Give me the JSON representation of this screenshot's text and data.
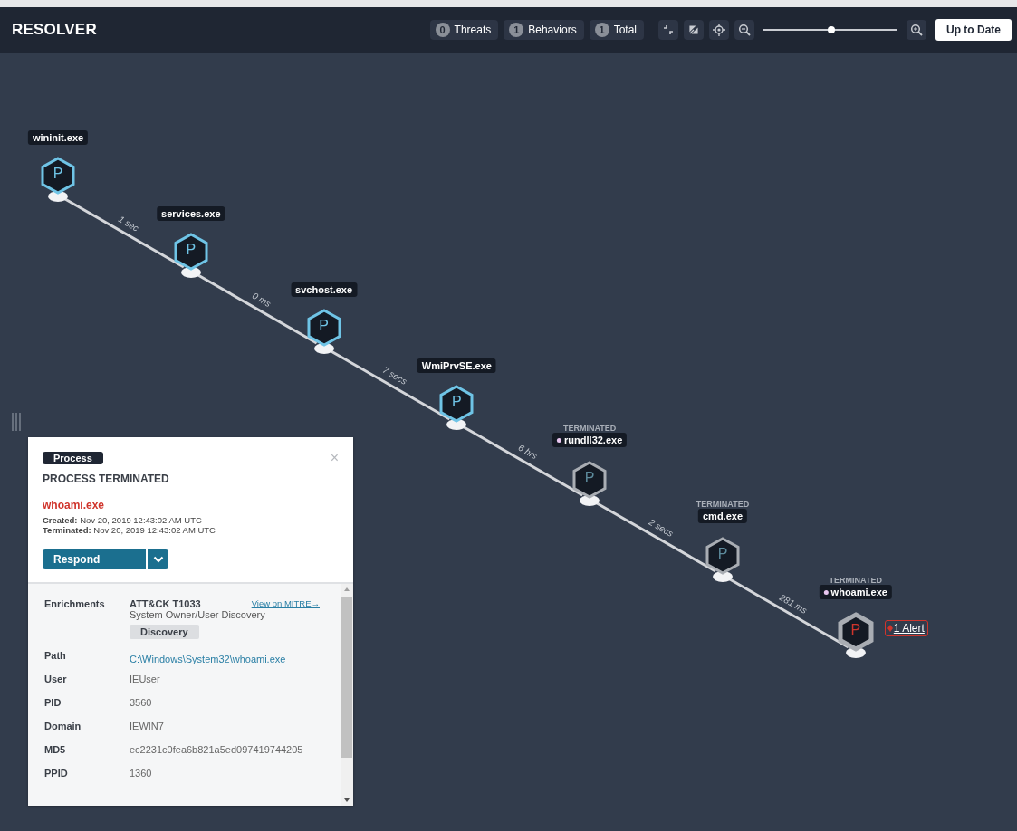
{
  "header": {
    "title": "RESOLVER",
    "counters": [
      {
        "count": "0",
        "label": "Threats"
      },
      {
        "count": "1",
        "label": "Behaviors"
      },
      {
        "count": "1",
        "label": "Total"
      }
    ],
    "zoom": {
      "level": 0.51
    },
    "status_button": "Up to Date"
  },
  "graph": {
    "nodes": [
      {
        "name": "wininit.exe",
        "glyph": "P",
        "terminated": false,
        "alert": false
      },
      {
        "name": "services.exe",
        "glyph": "P",
        "terminated": false,
        "alert": false
      },
      {
        "name": "svchost.exe",
        "glyph": "P",
        "terminated": false,
        "alert": false
      },
      {
        "name": "WmiPrvSE.exe",
        "glyph": "P",
        "terminated": false,
        "alert": false
      },
      {
        "name": "rundll32.exe",
        "glyph": "P",
        "terminated": true,
        "status": "TERMINATED",
        "color": "#e8c6f0",
        "alert": false
      },
      {
        "name": "cmd.exe",
        "glyph": "P",
        "terminated": true,
        "status": "TERMINATED",
        "alert": false
      },
      {
        "name": "whoami.exe",
        "glyph": "P",
        "terminated": true,
        "status": "TERMINATED",
        "color": "#e8c6f0",
        "alert": true,
        "alert_label": "1 Alert"
      }
    ],
    "edges": [
      "1 sec",
      "0 ms",
      "7 secs",
      "6 hrs",
      "2 secs",
      "281 ms"
    ]
  },
  "panel": {
    "close": "×",
    "tag": "Process",
    "heading": "PROCESS TERMINATED",
    "process": "whoami.exe",
    "times": [
      "**Created:** Nov 20, 2019 12:43:02 AM UTC",
      "**Terminated:** Nov 20, 2019 12:43:02 AM UTC"
    ],
    "action": "Respond",
    "details": [
      {
        "kind": "enrichment",
        "label": "Enrichments",
        "title": "ATT&CK T1033",
        "link": "View on MITRE→",
        "description": "System Owner/User Discovery",
        "tag": "Discovery"
      },
      {
        "kind": "link",
        "label": "Path",
        "value": "C:\\Windows\\System32\\whoami.exe"
      },
      {
        "kind": "text",
        "label": "User",
        "value": "IEUser"
      },
      {
        "kind": "text",
        "label": "PID",
        "value": "3560"
      },
      {
        "kind": "text",
        "label": "Domain",
        "value": "IEWIN7"
      },
      {
        "kind": "text",
        "label": "MD5",
        "value": "ec2231c0fea6b821a5ed097419744205"
      },
      {
        "kind": "text",
        "label": "PPID",
        "value": "1360"
      }
    ]
  }
}
